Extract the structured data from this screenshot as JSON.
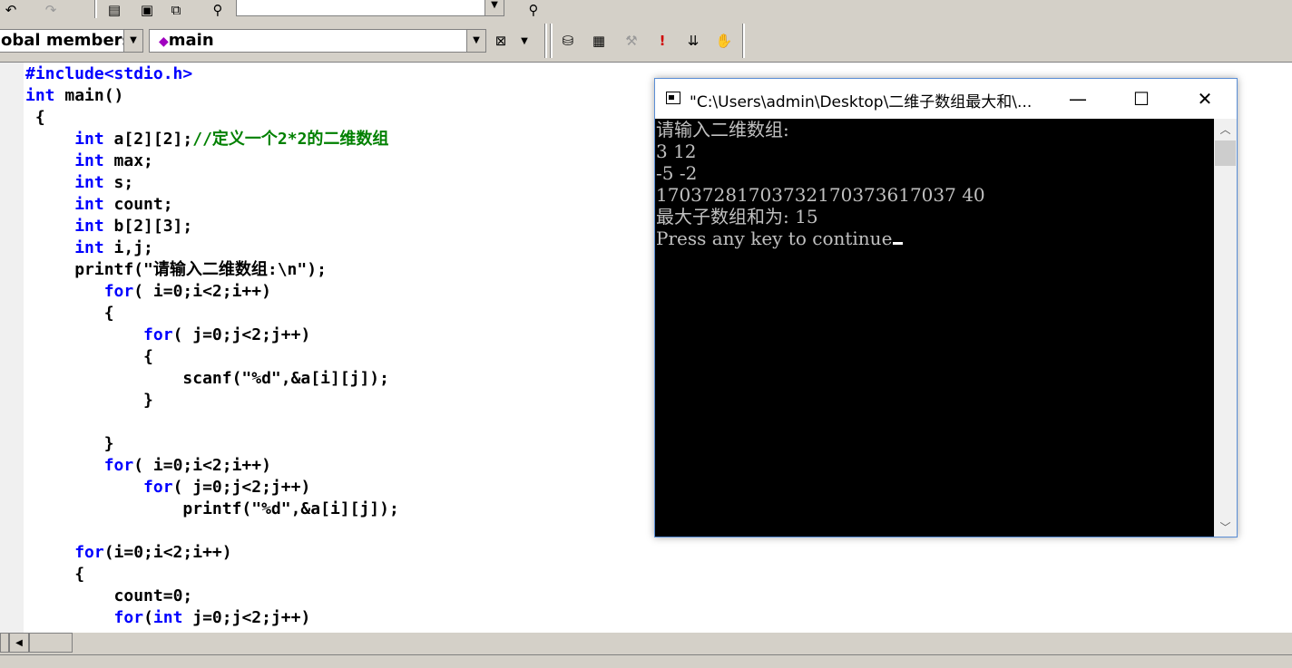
{
  "toolbar": {
    "class_combo": "obal members",
    "function_combo": "main",
    "top_combo_value": ""
  },
  "editor": {
    "lines": [
      {
        "type": "pp",
        "text": "#include<stdio.h>"
      },
      {
        "kw": "int",
        "rest": " main()"
      },
      {
        "text": " {"
      },
      {
        "indent": "     ",
        "kw": "int",
        "rest": " a[2][2];",
        "comment": "//定义一个2*2的二维数组"
      },
      {
        "indent": "     ",
        "kw": "int",
        "rest": " max;"
      },
      {
        "indent": "     ",
        "kw": "int",
        "rest": " s;"
      },
      {
        "indent": "     ",
        "kw": "int",
        "rest": " count;"
      },
      {
        "indent": "     ",
        "kw": "int",
        "rest": " b[2][3];"
      },
      {
        "indent": "     ",
        "kw": "int",
        "rest": " i,j;"
      },
      {
        "indent": "     ",
        "rest": "printf(\"请输入二维数组:\\n\");"
      },
      {
        "indent": "        ",
        "kw": "for",
        "rest": "( i=0;i<2;i++)"
      },
      {
        "indent": "        ",
        "rest": "{"
      },
      {
        "indent": "            ",
        "kw": "for",
        "rest": "( j=0;j<2;j++)"
      },
      {
        "indent": "            ",
        "rest": "{"
      },
      {
        "indent": "                ",
        "rest": "scanf(\"%d\",&a[i][j]);"
      },
      {
        "indent": "            ",
        "rest": "}"
      },
      {
        "text": ""
      },
      {
        "indent": "        ",
        "rest": "}"
      },
      {
        "indent": "        ",
        "kw": "for",
        "rest": "( i=0;i<2;i++)"
      },
      {
        "indent": "            ",
        "kw": "for",
        "rest": "( j=0;j<2;j++)"
      },
      {
        "indent": "                ",
        "rest": "printf(\"%d\",&a[i][j]);"
      },
      {
        "text": ""
      },
      {
        "indent": "     ",
        "kw": "for",
        "rest": "(i=0;i<2;i++)"
      },
      {
        "indent": "     ",
        "rest": "{"
      },
      {
        "indent": "         ",
        "rest": "count=0;"
      },
      {
        "indent": "         ",
        "kw": "for",
        "rest": "(",
        "kw2": "int",
        "rest2": " j=0;j<2;j++)"
      }
    ]
  },
  "console": {
    "title": "\"C:\\Users\\admin\\Desktop\\二维子数组最大和\\...",
    "minimize_glyph": "—",
    "maximize_glyph": "☐",
    "close_glyph": "✕",
    "lines": [
      "请输入二维数组:",
      "3 12",
      "-5 -2",
      "17037281703732170373617037 40",
      "最大子数组和为: 15",
      "Press any key to continue"
    ]
  }
}
